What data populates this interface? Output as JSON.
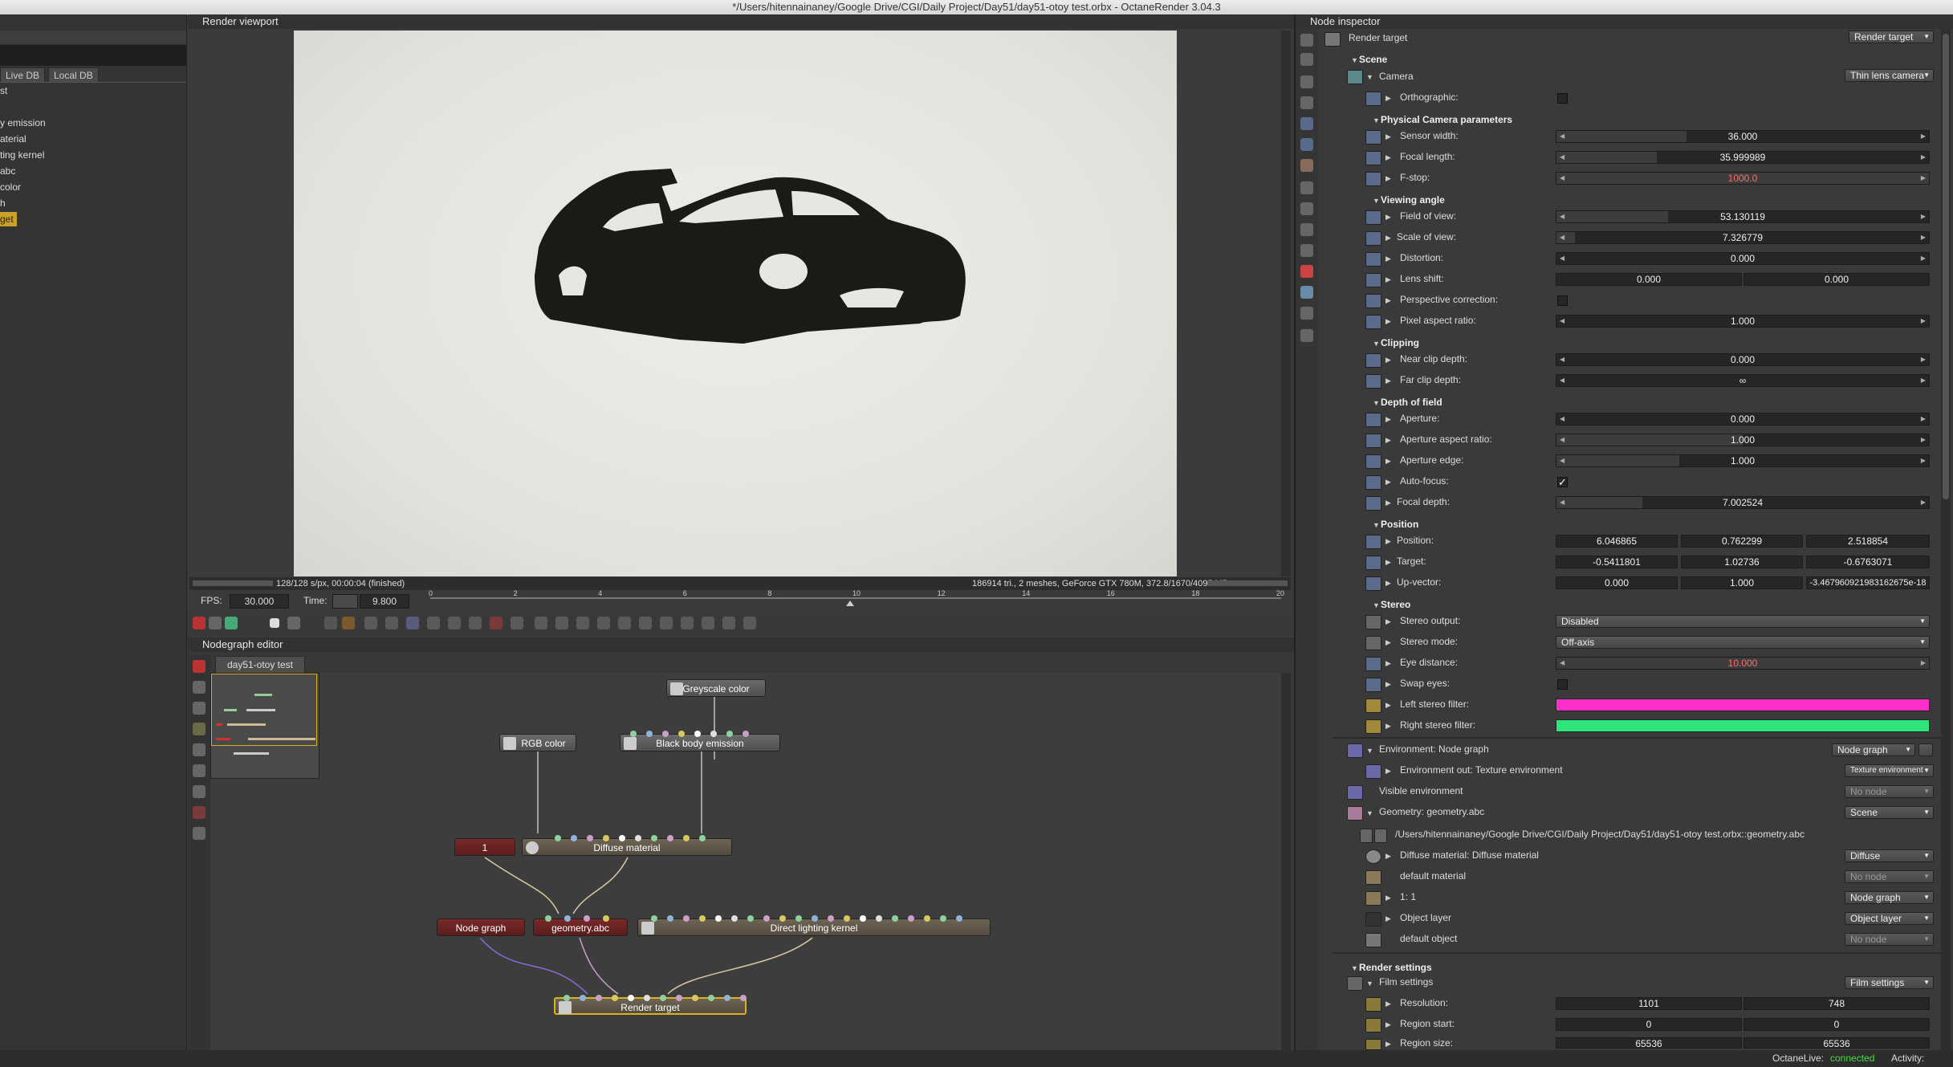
{
  "window": {
    "title": "*/Users/hitennainaney/Google Drive/CGI/Daily Project/Day51/day51-otoy test.orbx - OctaneRender 3.04.3"
  },
  "left_panel": {
    "tabs": [
      "Live DB",
      "Local DB"
    ],
    "items": [
      "st",
      "y emission",
      "aterial",
      "ting kernel",
      "abc",
      "color",
      "h",
      "get"
    ]
  },
  "viewport": {
    "title": "Render viewport",
    "status_left": "128/128 s/px, 00:00:04 (finished)",
    "status_right": "186914 tri., 2 meshes, GeForce GTX 780M, 372.8/1670/4095 MB",
    "fps_label": "FPS:",
    "fps_value": "30.000",
    "time_label": "Time:",
    "time_value": "9.800",
    "timeline_ticks": [
      "0",
      "2",
      "4",
      "6",
      "8",
      "10",
      "12",
      "14",
      "16",
      "18",
      "20"
    ]
  },
  "node_editor": {
    "title": "Nodegraph editor",
    "tab": "day51-otoy test",
    "nodes": {
      "greyscale": "Greyscale color",
      "rgb": "RGB color",
      "blackbody": "Black body emission",
      "one": "1",
      "diffuse": "Diffuse material",
      "nodegraph": "Node graph",
      "geometry": "geometry.abc",
      "direct": "Direct lighting kernel",
      "render_target": "Render target"
    }
  },
  "inspector": {
    "title": "Node inspector",
    "header_label": "Render target",
    "header_dropdown": "Render target",
    "scene": "Scene",
    "camera": {
      "label": "Camera",
      "dropdown": "Thin lens camera"
    },
    "orthographic": "Orthographic:",
    "phys_section": "Physical Camera parameters",
    "sensor_width": {
      "label": "Sensor width:",
      "value": "36.000"
    },
    "focal_length": {
      "label": "Focal length:",
      "value": "35.999989"
    },
    "fstop": {
      "label": "F-stop:",
      "value": "1000.0"
    },
    "viewing_section": "Viewing angle",
    "fov": {
      "label": "Field of view:",
      "value": "53.130119"
    },
    "scale_view": {
      "label": "Scale of view:",
      "value": "7.326779"
    },
    "distortion": {
      "label": "Distortion:",
      "value": "0.000"
    },
    "lens_shift": {
      "label": "Lens shift:",
      "value1": "0.000",
      "value2": "0.000"
    },
    "perspective": "Perspective correction:",
    "pixel_aspect": {
      "label": "Pixel aspect ratio:",
      "value": "1.000"
    },
    "clipping_section": "Clipping",
    "near_clip": {
      "label": "Near clip depth:",
      "value": "0.000"
    },
    "far_clip": {
      "label": "Far clip depth:",
      "value": "∞"
    },
    "dof_section": "Depth of field",
    "aperture": {
      "label": "Aperture:",
      "value": "0.000"
    },
    "aperture_aspect": {
      "label": "Aperture aspect ratio:",
      "value": "1.000"
    },
    "aperture_edge": {
      "label": "Aperture edge:",
      "value": "1.000"
    },
    "autofocus": {
      "label": "Auto-focus:",
      "check": "✓"
    },
    "focal_depth": {
      "label": "Focal depth:",
      "value": "7.002524"
    },
    "position_section": "Position",
    "position": {
      "label": "Position:",
      "x": "6.046865",
      "y": "0.762299",
      "z": "2.518854"
    },
    "target": {
      "label": "Target:",
      "x": "-0.5411801",
      "y": "1.02736",
      "z": "-0.6763071"
    },
    "up_vector": {
      "label": "Up-vector:",
      "x": "0.000",
      "y": "1.000",
      "z": "-3.467960921983162675e-18"
    },
    "stereo_section": "Stereo",
    "stereo_output": {
      "label": "Stereo output:",
      "value": "Disabled"
    },
    "stereo_mode": {
      "label": "Stereo mode:",
      "value": "Off-axis"
    },
    "eye_distance": {
      "label": "Eye distance:",
      "value": "10.000"
    },
    "swap_eyes": "Swap eyes:",
    "left_filter": {
      "label": "Left stereo filter:",
      "color": "#ff2ec9"
    },
    "right_filter": {
      "label": "Right stereo filter:",
      "color": "#2ee57a"
    },
    "environment": {
      "label": "Environment: Node graph",
      "dropdown": "Node graph"
    },
    "env_out": {
      "label": "Environment out: Texture environment",
      "dropdown": "Texture environment"
    },
    "visible_env": {
      "label": "Visible environment",
      "dropdown": "No node"
    },
    "geometry": {
      "label": "Geometry: geometry.abc",
      "dropdown": "Scene"
    },
    "geometry_path": "/Users/hitennainaney/Google Drive/CGI/Daily Project/Day51/day51-otoy test.orbx::geometry.abc",
    "diffuse_mat": {
      "label": "Diffuse material: Diffuse material",
      "dropdown": "Diffuse"
    },
    "default_material": {
      "label": "default material",
      "dropdown": "No node"
    },
    "one_one": {
      "label": "1: 1",
      "dropdown": "Node graph"
    },
    "object_layer": {
      "label": "Object layer",
      "dropdown": "Object layer"
    },
    "default_object": {
      "label": "default object",
      "dropdown": "No node"
    },
    "render_settings": "Render settings",
    "film_settings": {
      "label": "Film settings",
      "dropdown": "Film settings"
    },
    "resolution": {
      "label": "Resolution:",
      "x": "1101",
      "y": "748"
    },
    "region_start": {
      "label": "Region start:",
      "x": "0",
      "y": "0"
    },
    "region_size": {
      "label": "Region size:",
      "x": "65536",
      "y": "65536"
    }
  },
  "status_bar": {
    "octane_live_label": "OctaneLive:",
    "octane_live_value": "connected",
    "activity": "Activity:"
  }
}
